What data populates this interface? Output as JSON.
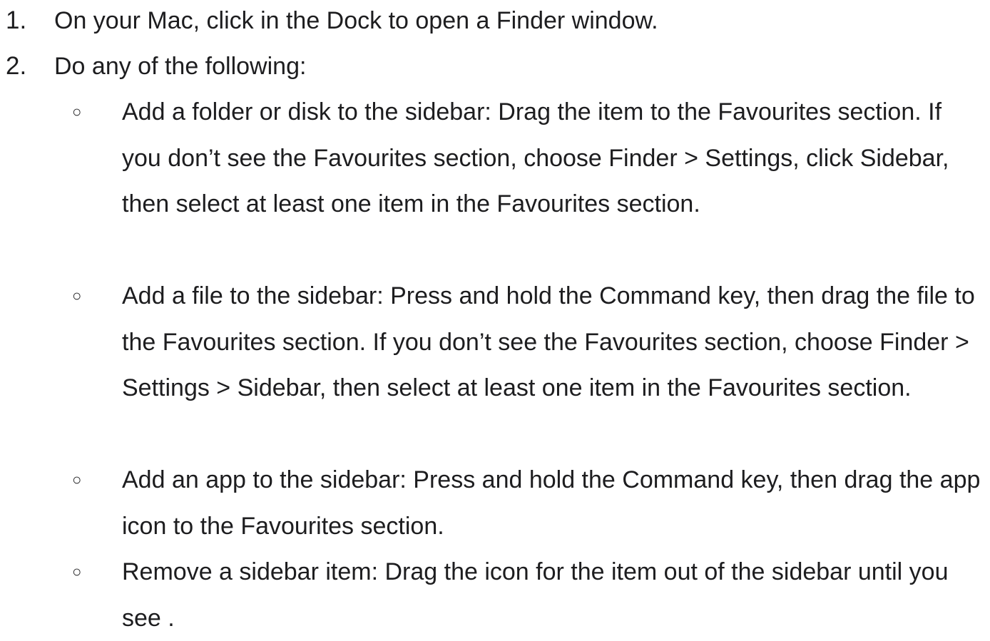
{
  "steps": [
    {
      "number": "1.",
      "text": "On your Mac, click  in the Dock to open a Finder window."
    },
    {
      "number": "2.",
      "text": "Do any of the following:"
    }
  ],
  "bullets": [
    {
      "mark": "○",
      "text": "Add a folder or disk to the sidebar: Drag the item to the Favourites section. If you don’t see the Favourites section, choose Finder > Settings, click Sidebar, then select at least one item in the Favourites section."
    },
    {
      "mark": "○",
      "text": "Add a file to the sidebar: Press and hold the Command key, then drag the file to the Favourites section. If you don’t see the Favourites section, choose Finder > Settings > Sidebar, then select at least one item in the Favourites section."
    },
    {
      "mark": "○",
      "text": "Add an app to the sidebar: Press and hold the Command key, then drag the app icon to the Favourites section."
    },
    {
      "mark": "○",
      "text": "Remove a sidebar item: Drag the icon for the item out of the sidebar until you see ."
    }
  ]
}
